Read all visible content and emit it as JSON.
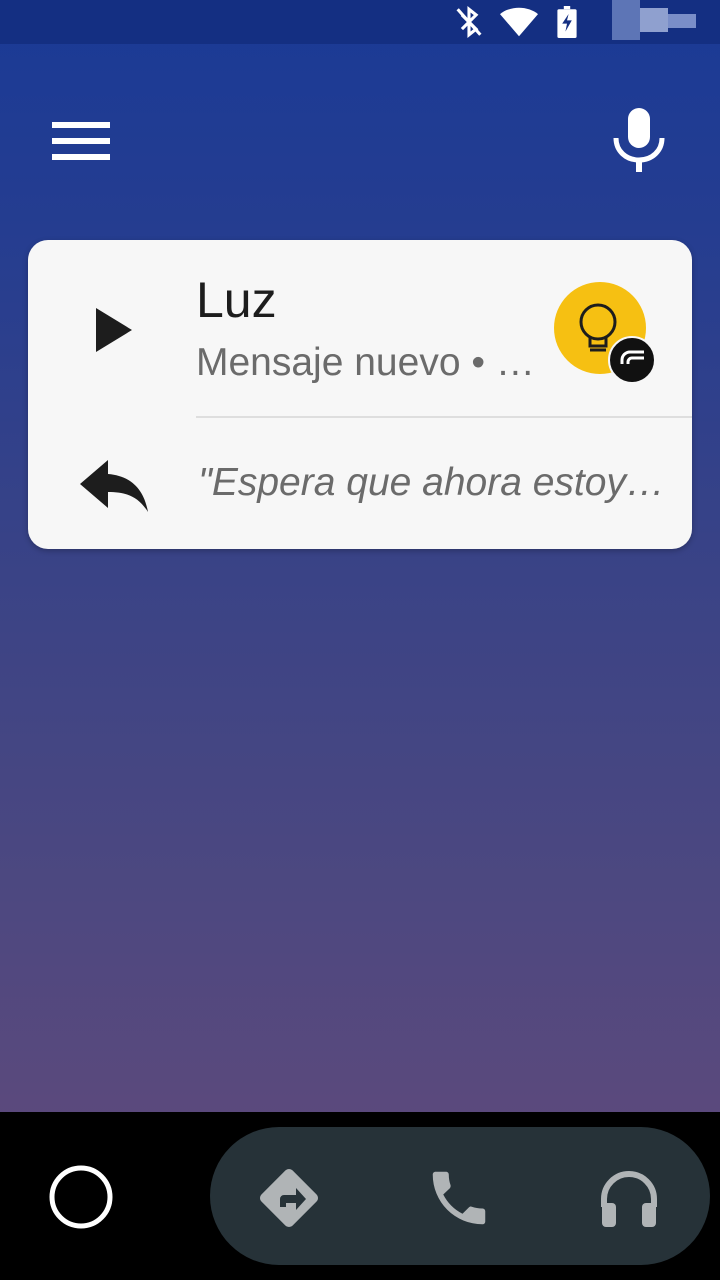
{
  "status_bar": {
    "icons": [
      "bluetooth-icon",
      "wifi-icon",
      "battery-icon"
    ],
    "colors": {
      "background": "#142f82",
      "icon": "#ffffff"
    }
  },
  "header": {
    "menu_icon": "menu-icon",
    "mic_icon": "microphone-icon"
  },
  "notification": {
    "sender": "Luz",
    "subtitle": "Mensaje nuevo • …",
    "reply_preview": "\"Espera que ahora estoy…",
    "play_icon": "play-icon",
    "reply_icon": "reply-icon",
    "avatar_icon": "lightbulb-icon",
    "badge_icon": "app-badge-icon",
    "colors": {
      "card": "#f7f7f7",
      "avatar": "#f6c012"
    }
  },
  "bottom_nav": {
    "home_icon": "home-circle-icon",
    "items": [
      {
        "name": "navigation",
        "icon": "directions-icon"
      },
      {
        "name": "phone",
        "icon": "phone-icon"
      },
      {
        "name": "audio",
        "icon": "headphones-icon"
      }
    ],
    "colors": {
      "bar": "#000000",
      "pill": "#263238",
      "icon": "#b0b4b6"
    }
  }
}
